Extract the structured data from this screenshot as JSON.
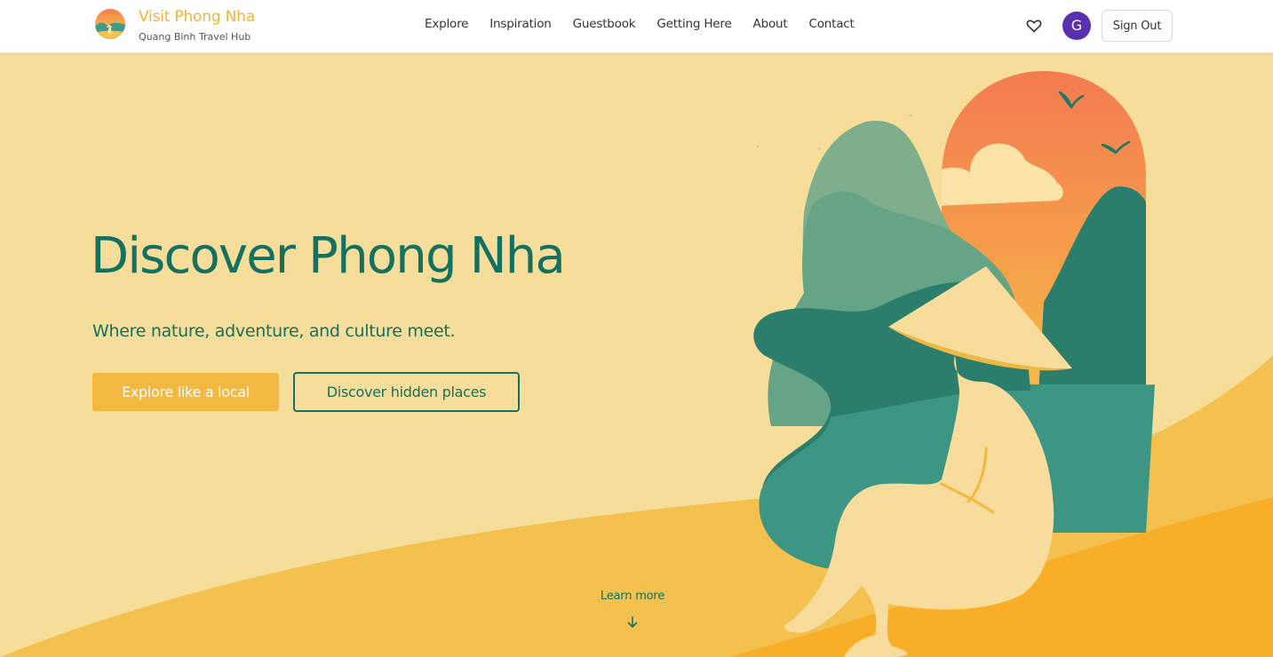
{
  "brand": {
    "name": "Visit Phong Nha",
    "subtitle": "Quang Binh Travel Hub",
    "logo_icon": "sunset-traveler-logo"
  },
  "nav": {
    "links": [
      "Explore",
      "Inspiration",
      "Guestbook",
      "Getting Here",
      "About",
      "Contact"
    ]
  },
  "user": {
    "favorites_icon": "heart-icon",
    "avatar_initial": "G",
    "sign_out_label": "Sign Out"
  },
  "hero": {
    "title": "Discover Phong Nha",
    "subtitle": "Where nature, adventure, and culture meet.",
    "primary_button": "Explore like a local",
    "secondary_button": "Discover hidden places",
    "learn_more": "Learn more",
    "learn_more_icon": "arrow-down-icon"
  },
  "colors": {
    "background": "#f7dd9a",
    "accent": "#f2b840",
    "primary_green": "#14705f",
    "avatar": "#5a2fb0"
  }
}
